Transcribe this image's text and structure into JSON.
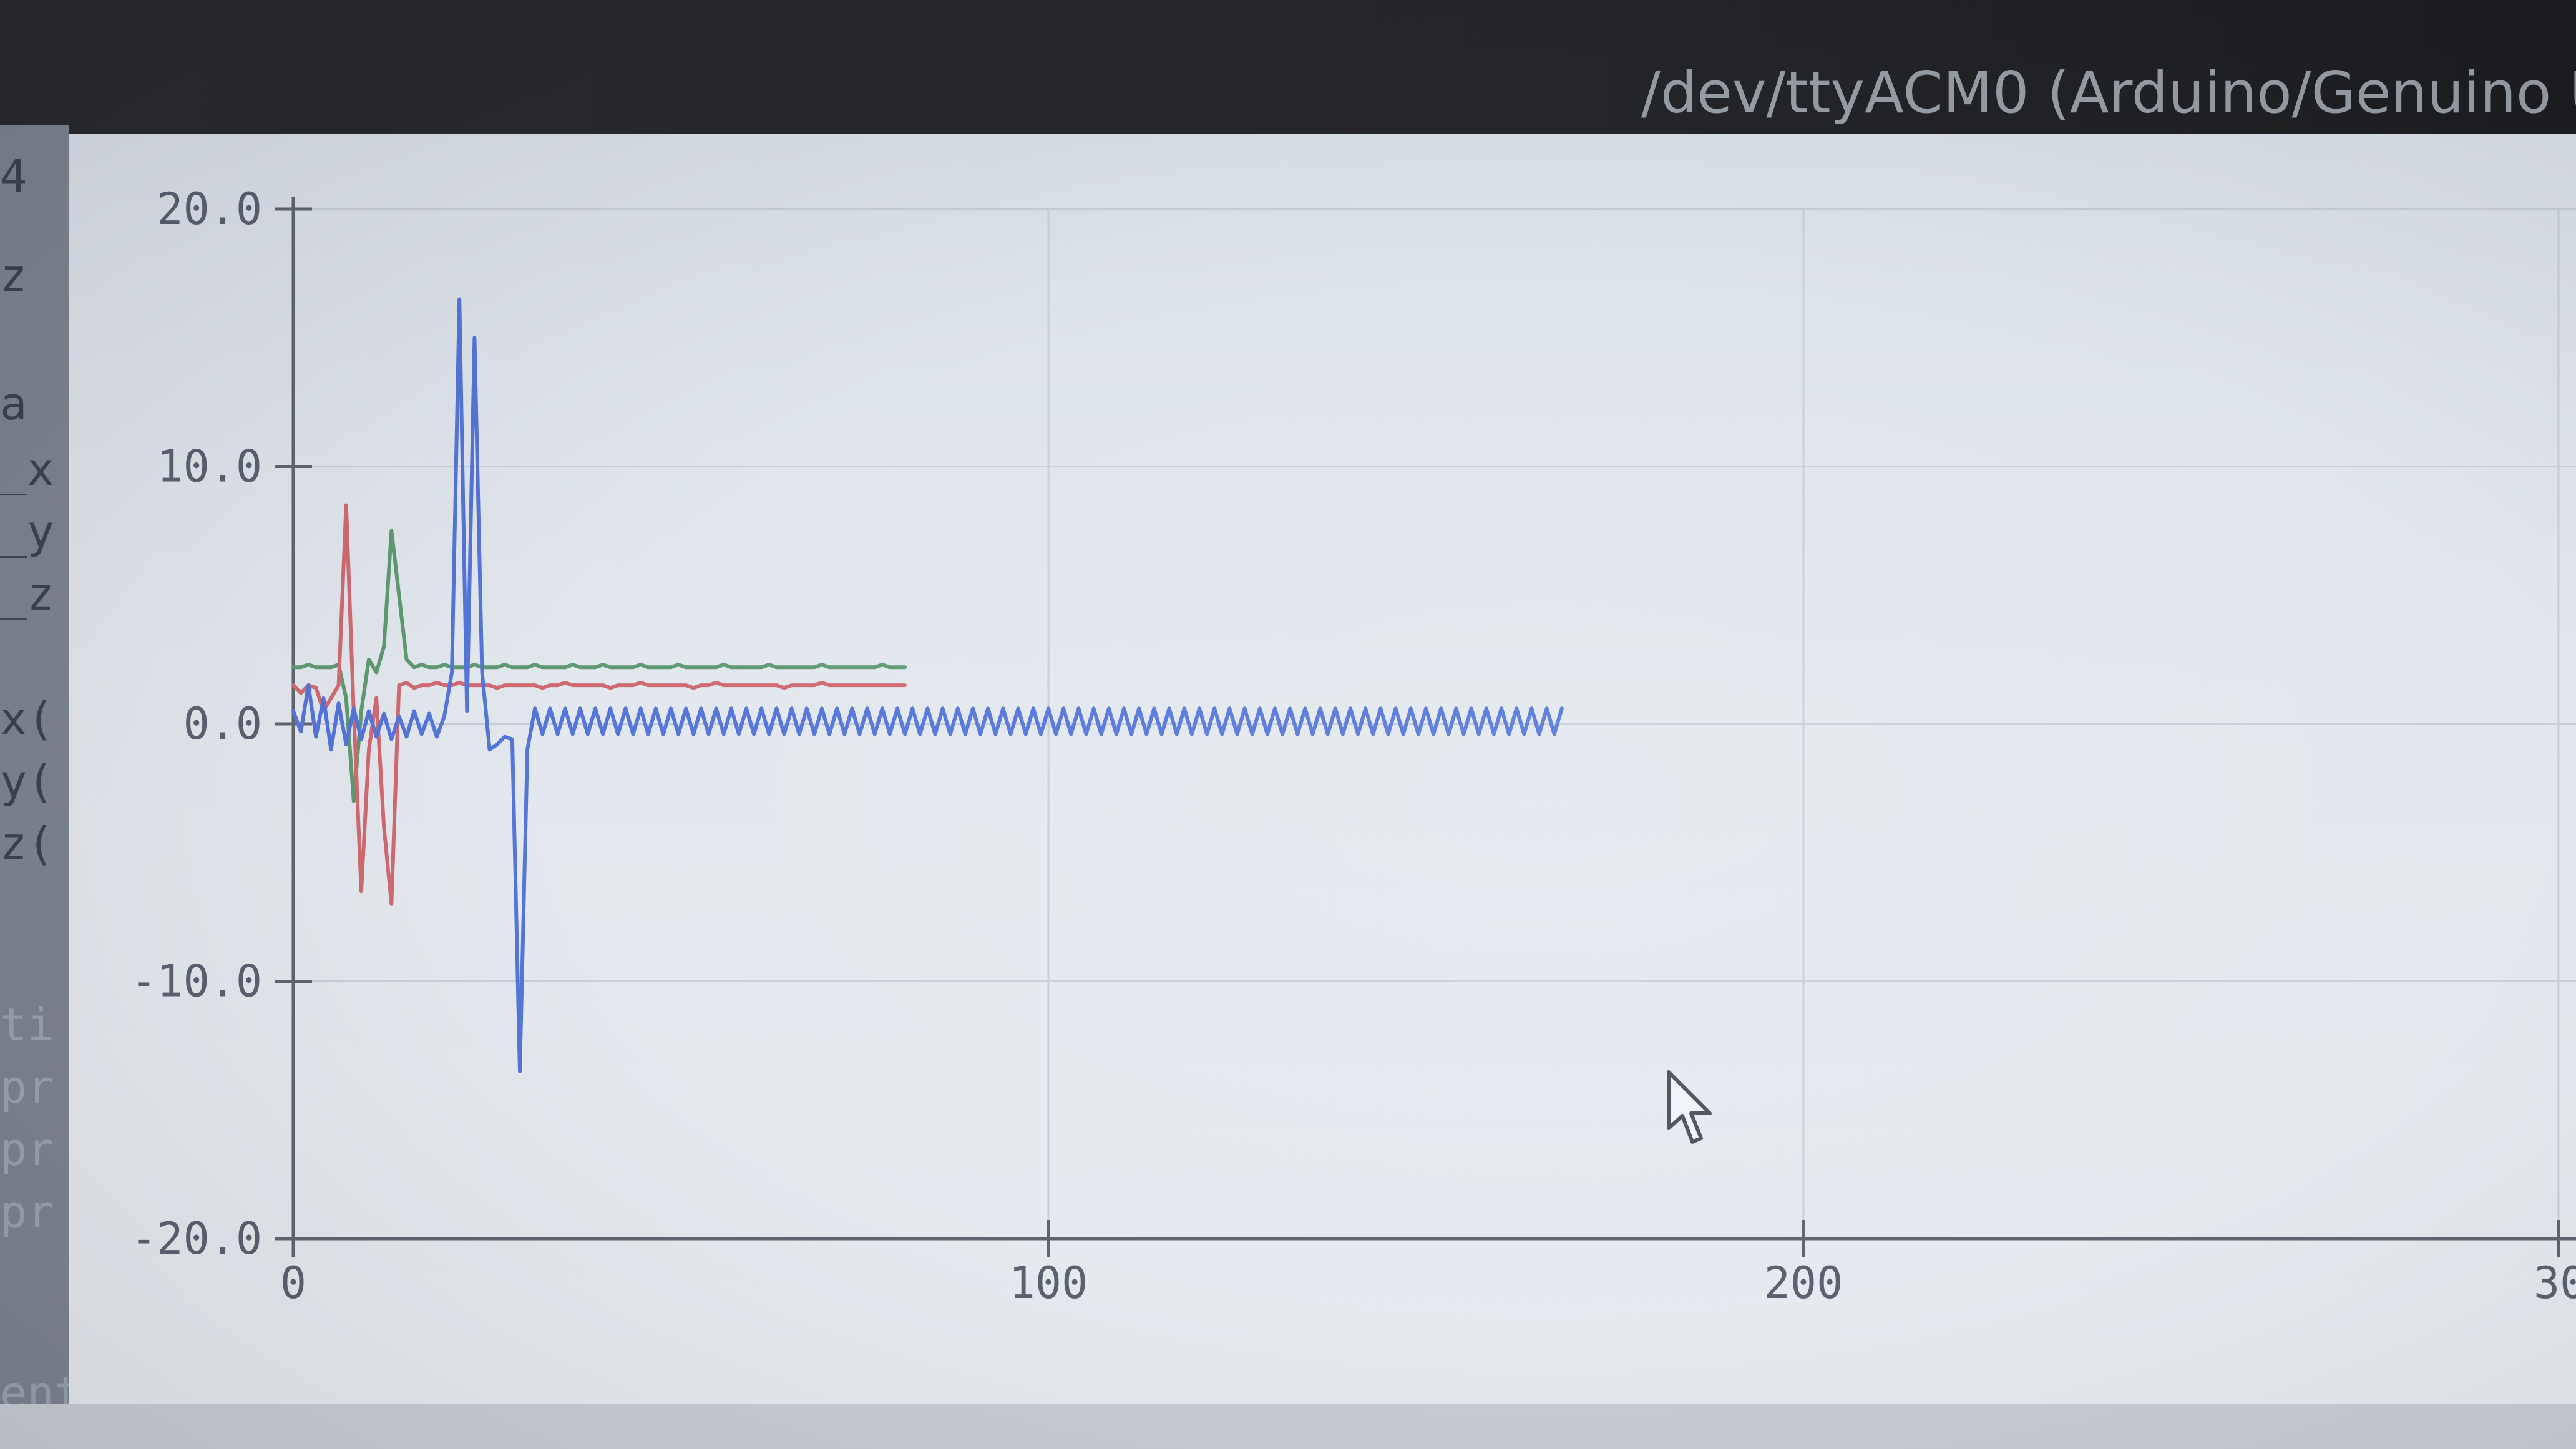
{
  "window": {
    "title": "/dev/ttyACM0 (Arduino/Genuino U"
  },
  "left_strip": {
    "lines": [
      "4",
      "z",
      "a",
      "_x",
      "_y",
      "_z",
      "x(",
      "y(",
      "z(",
      "ti",
      "pr",
      "pr",
      "pr",
      "ent"
    ]
  },
  "colors": {
    "series_blue": "#5575d8",
    "series_red": "#d06a72",
    "series_green": "#5f9a72",
    "axis": "#60666f",
    "grid": "#c8ced8"
  },
  "chart_data": {
    "type": "line",
    "title": "",
    "xlabel": "",
    "ylabel": "",
    "xlim": [
      0,
      300
    ],
    "ylim": [
      -20,
      20
    ],
    "x_ticks": [
      "0",
      "100",
      "200",
      "30"
    ],
    "y_ticks": [
      "20.0",
      "10.0",
      "0.0",
      "-10.0",
      "-20.0"
    ],
    "grid": true,
    "legend": "none",
    "series": [
      {
        "color": "#5575d8",
        "values": [
          0.5,
          -0.3,
          1.5,
          -0.5,
          1.0,
          -1.0,
          0.8,
          -0.8,
          0.6,
          -0.6,
          0.5,
          -0.5,
          0.4,
          -0.6,
          0.3,
          -0.5,
          0.5,
          -0.4,
          0.4,
          -0.5,
          0.3,
          2.0,
          16.5,
          0.5,
          15.0,
          2.0,
          -1.0,
          -0.8,
          -0.5,
          -0.6,
          -13.5,
          -1.0,
          0.6,
          -0.4,
          0.6,
          -0.4,
          0.6,
          -0.4,
          0.6,
          -0.4,
          0.6,
          -0.4,
          0.6,
          -0.4,
          0.6,
          -0.4,
          0.6,
          -0.4,
          0.6,
          -0.4,
          0.6,
          -0.4,
          0.6,
          -0.4,
          0.6,
          -0.4,
          0.6,
          -0.4,
          0.6,
          -0.4,
          0.6,
          -0.4,
          0.6,
          -0.4,
          0.6,
          -0.4,
          0.6,
          -0.4,
          0.6,
          -0.4,
          0.6,
          -0.4,
          0.6,
          -0.4,
          0.6,
          -0.4,
          0.6,
          -0.4,
          0.6,
          -0.4,
          0.6,
          -0.4,
          0.6,
          -0.4,
          0.6,
          -0.4,
          0.6,
          -0.4,
          0.6,
          -0.4,
          0.6,
          -0.4,
          0.6,
          -0.4,
          0.6,
          -0.4,
          0.6,
          -0.4,
          0.6,
          -0.4,
          0.6,
          -0.4,
          0.6,
          -0.4,
          0.6,
          -0.4,
          0.6,
          -0.4,
          0.6,
          -0.4,
          0.6,
          -0.4,
          0.6,
          -0.4,
          0.6,
          -0.4,
          0.6,
          -0.4,
          0.6,
          -0.4,
          0.6,
          -0.4,
          0.6,
          -0.4,
          0.6,
          -0.4,
          0.6,
          -0.4,
          0.6,
          -0.4,
          0.6,
          -0.4,
          0.6,
          -0.4,
          0.6,
          -0.4,
          0.6,
          -0.4,
          0.6,
          -0.4,
          0.6,
          -0.4,
          0.6,
          -0.4,
          0.6,
          -0.4,
          0.6,
          -0.4,
          0.6,
          -0.4,
          0.6,
          -0.4,
          0.6,
          -0.4,
          0.6,
          -0.4,
          0.6,
          -0.4,
          0.6,
          -0.4,
          0.6,
          -0.4,
          0.6,
          -0.4,
          0.6,
          -0.4,
          0.6,
          -0.4,
          0.6
        ]
      },
      {
        "color": "#d06a72",
        "values": [
          1.5,
          1.2,
          1.5,
          1.4,
          0.5,
          1.0,
          1.5,
          8.5,
          0.5,
          -6.5,
          -1.0,
          1.0,
          -4.0,
          -7.0,
          1.5,
          1.6,
          1.4,
          1.5,
          1.5,
          1.6,
          1.5,
          1.5,
          1.6,
          1.5,
          1.5,
          1.5,
          1.5,
          1.4,
          1.5,
          1.5,
          1.5,
          1.5,
          1.5,
          1.4,
          1.5,
          1.5,
          1.6,
          1.5,
          1.5,
          1.5,
          1.5,
          1.5,
          1.4,
          1.5,
          1.5,
          1.5,
          1.6,
          1.5,
          1.5,
          1.5,
          1.5,
          1.5,
          1.5,
          1.4,
          1.5,
          1.5,
          1.6,
          1.5,
          1.5,
          1.5,
          1.5,
          1.5,
          1.5,
          1.5,
          1.5,
          1.4,
          1.5,
          1.5,
          1.5,
          1.5,
          1.6,
          1.5,
          1.5,
          1.5,
          1.5,
          1.5,
          1.5,
          1.5,
          1.5,
          1.5,
          1.5,
          1.5
        ]
      },
      {
        "color": "#5f9a72",
        "values": [
          2.2,
          2.2,
          2.3,
          2.2,
          2.2,
          2.2,
          2.3,
          1.0,
          -3.0,
          0.5,
          2.5,
          2.0,
          3.0,
          7.5,
          5.0,
          2.5,
          2.2,
          2.3,
          2.2,
          2.2,
          2.3,
          2.2,
          2.2,
          2.2,
          2.3,
          2.2,
          2.2,
          2.2,
          2.3,
          2.2,
          2.2,
          2.2,
          2.3,
          2.2,
          2.2,
          2.2,
          2.2,
          2.3,
          2.2,
          2.2,
          2.2,
          2.3,
          2.2,
          2.2,
          2.2,
          2.2,
          2.3,
          2.2,
          2.2,
          2.2,
          2.2,
          2.3,
          2.2,
          2.2,
          2.2,
          2.2,
          2.2,
          2.3,
          2.2,
          2.2,
          2.2,
          2.2,
          2.2,
          2.3,
          2.2,
          2.2,
          2.2,
          2.2,
          2.2,
          2.2,
          2.3,
          2.2,
          2.2,
          2.2,
          2.2,
          2.2,
          2.2,
          2.2,
          2.3,
          2.2,
          2.2,
          2.2
        ]
      }
    ]
  }
}
